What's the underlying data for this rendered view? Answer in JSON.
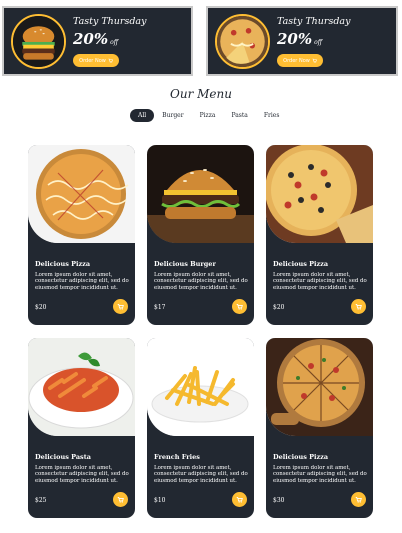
{
  "offers": [
    {
      "title": "Tasty Thursday",
      "discount": "20%",
      "off_label": "off",
      "button": "Order Now",
      "image": "burger"
    },
    {
      "title": "Tasty Thursday",
      "discount": "20%",
      "off_label": "off",
      "button": "Order Now",
      "image": "pizza-slice"
    }
  ],
  "menu": {
    "title": "Our Menu",
    "filters": [
      "All",
      "Burger",
      "Pizza",
      "Pasta",
      "Fries"
    ],
    "active_filter": "All",
    "items": [
      {
        "name": "Delicious Pizza",
        "description": "Lorem ipsum dolor sit amet, consectetur adipiscing elit, sed do eiusmod tempor incididunt ut.",
        "price": "$20",
        "image": "pizza"
      },
      {
        "name": "Delicious Burger",
        "description": "Lorem ipsum dolor sit amet, consectetur adipiscing elit, sed do eiusmod tempor incididunt ut.",
        "price": "$17",
        "image": "burger"
      },
      {
        "name": "Delicious Pizza",
        "description": "Lorem ipsum dolor sit amet, consectetur adipiscing elit, sed do eiusmod tempor incididunt ut.",
        "price": "$20",
        "image": "pizza-olives"
      },
      {
        "name": "Delicious Pasta",
        "description": "Lorem ipsum dolor sit amet, consectetur adipiscing elit, sed do eiusmod tempor incididunt ut.",
        "price": "$25",
        "image": "pasta"
      },
      {
        "name": "French Fries",
        "description": "Lorem ipsum dolor sit amet, consectetur adipiscing elit, sed do eiusmod tempor incididunt ut.",
        "price": "$10",
        "image": "fries"
      },
      {
        "name": "Delicious Pizza",
        "description": "Lorem ipsum dolor sit amet, consectetur adipiscing elit, sed do eiusmod tempor incididunt ut.",
        "price": "$30",
        "image": "pizza-board"
      }
    ]
  },
  "colors": {
    "dark": "#222831",
    "accent": "#ffbe33",
    "background": "#ffffff"
  },
  "icons": {
    "cart": "cart-icon"
  }
}
